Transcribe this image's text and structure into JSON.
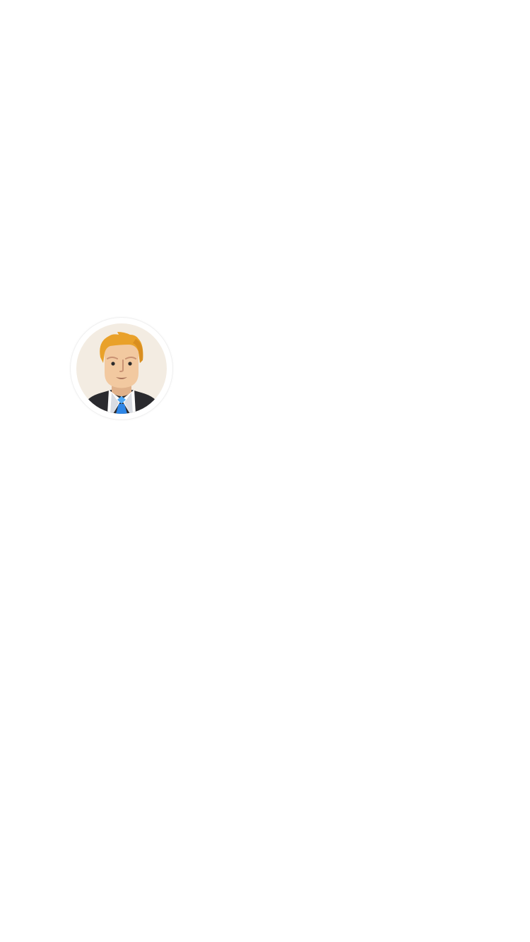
{
  "avatar": {
    "icon": "user-avatar-businessman",
    "colors": {
      "background": "#F3ECE2",
      "skin": "#F2C9A0",
      "skin_shadow": "#E0B18A",
      "hair": "#E9A12A",
      "hair_shadow": "#D98E1F",
      "suit": "#2A2A2E",
      "shirt": "#FFFFFF",
      "collar_shadow": "#C9CDD6",
      "tie": "#2E86E6",
      "tie_light": "#4FA8F5",
      "mouth": "#A9735A",
      "eye": "#2B2B2B",
      "nose": "#C99273"
    }
  }
}
